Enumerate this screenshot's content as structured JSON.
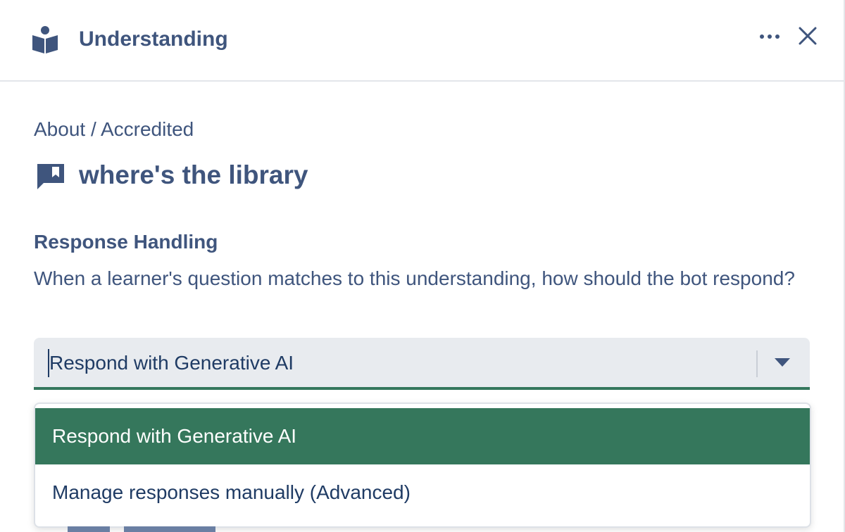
{
  "header": {
    "title": "Understanding",
    "icon": "reading-book-icon",
    "more_icon": "more-horizontal-icon",
    "close_icon": "close-icon"
  },
  "breadcrumb": "About / Accredited",
  "question": {
    "icon": "chat-bubble-bookmark-icon",
    "title": "where's the library"
  },
  "response_handling": {
    "title": "Response Handling",
    "description": "When a learner's question matches to this understanding, how should the bot respond?",
    "select": {
      "value": "Respond with Generative AI",
      "arrow_icon": "chevron-down-icon"
    },
    "options": [
      {
        "label": "Respond with Generative AI",
        "selected": true
      },
      {
        "label": "Manage responses manually (Advanced)",
        "selected": false
      }
    ]
  },
  "colors": {
    "text": "#3f557d",
    "text_dark": "#1f3b64",
    "accent_green": "#35775c",
    "select_bg": "#e8ebef",
    "border": "#e3e6ea"
  }
}
